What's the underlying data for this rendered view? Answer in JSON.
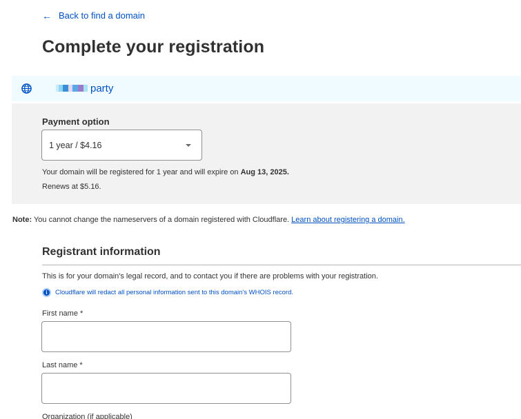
{
  "header": {
    "back_link": "Back to find a domain",
    "page_title": "Complete your registration"
  },
  "domain": {
    "icon": "globe-icon",
    "name_redacted": true,
    "tld_label": "party",
    "colors": {
      "link": "#0051c3",
      "bar_background": "#effbfe"
    }
  },
  "payment": {
    "label": "Payment option",
    "selected_option": "1 year / $4.16",
    "desc_prefix": "Your domain will be registered for 1 year and will expire on ",
    "expiry_date": "Aug 13, 2025.",
    "renewal": "Renews at $5.16."
  },
  "note": {
    "label": "Note:",
    "text": " You cannot change the nameservers of a domain registered with Cloudflare. ",
    "link": "Learn about registering a domain."
  },
  "registrant": {
    "title": "Registrant information",
    "description": "This is for your domain's legal record, and to contact you if there are problems with your registration.",
    "info_icon": "info-icon",
    "info_text": "Cloudflare will redact all personal information sent to this domain's WHOIS record.",
    "fields": [
      {
        "label": "First name *",
        "value": "",
        "placeholder": ""
      },
      {
        "label": "Last name *",
        "value": "",
        "placeholder": ""
      },
      {
        "label": "Organization (if applicable)"
      }
    ]
  }
}
